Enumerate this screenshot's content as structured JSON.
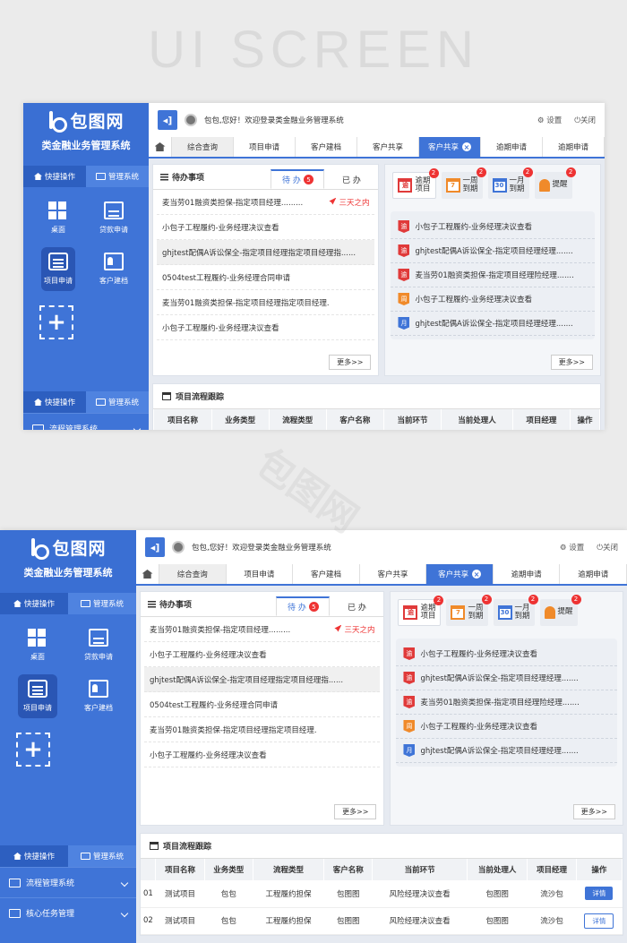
{
  "hero_title": "UI SCREEN",
  "brand": {
    "logo": "包图网",
    "system": "类金融业务管理系统"
  },
  "sidebar": {
    "tab_quick": "快捷操作",
    "tab_manage": "管理系统",
    "grid": [
      {
        "label": "桌面",
        "icon": "desktop-icon"
      },
      {
        "label": "贷款申请",
        "icon": "loan-icon"
      },
      {
        "label": "项目申请",
        "icon": "project-icon",
        "selected": true
      },
      {
        "label": "客户建档",
        "icon": "customer-icon"
      }
    ],
    "add_label": "+",
    "menu": [
      {
        "label": "流程管理系统"
      },
      {
        "label": "核心任务管理"
      }
    ]
  },
  "topbar": {
    "back": "◂]",
    "welcome": "包包,您好！欢迎登录类金融业务管理系统",
    "settings": "设置",
    "logout": "关闭"
  },
  "navtabs": [
    "综合查询",
    "项目申请",
    "客户建档",
    "客户共享",
    "客户共享",
    "逾期申请",
    "逾期申请"
  ],
  "todo": {
    "title": "待办事项",
    "tab_todo": "待 办",
    "tab_todo_count": "5",
    "tab_done": "已 办",
    "urgent": "三天之内",
    "items": [
      "麦当劳01融资类担保-指定项目经理.........",
      "小包子工程履约-业务经理决议查看",
      "ghjtest配偶A诉讼保全-指定项目经理指定项目经理指......",
      "0504test工程履约-业务经理合同申请",
      "麦当劳01融资类担保-指定项目经理指定项目经理.",
      "小包子工程履约-业务经理决议查看"
    ],
    "more": "更多>>"
  },
  "alerts": {
    "cats": [
      {
        "l1": "逾期",
        "l2": "项目",
        "cal": "逾",
        "color": "#e03a3a",
        "badge": "2"
      },
      {
        "l1": "一周",
        "l2": "到期",
        "cal": "7",
        "color": "#f08a2a",
        "badge": "2"
      },
      {
        "l1": "一月",
        "l2": "到期",
        "cal": "30",
        "color": "#3f74d7",
        "badge": "2"
      },
      {
        "l1": "提醒",
        "l2": "",
        "cal": "",
        "color": "#f08a2a",
        "badge": "2"
      }
    ],
    "items": [
      {
        "tag": "逾",
        "color": "#e03a3a",
        "text": "小包子工程履约-业务经理决议查看"
      },
      {
        "tag": "逾",
        "color": "#e03a3a",
        "text": "ghjtest配偶A诉讼保全-指定项目经理经理......."
      },
      {
        "tag": "逾",
        "color": "#e03a3a",
        "text": "麦当劳01融资类担保-指定项目经理险经理......."
      },
      {
        "tag": "周",
        "color": "#f08a2a",
        "text": "小包子工程履约-业务经理决议查看"
      },
      {
        "tag": "月",
        "color": "#3f74d7",
        "text": "ghjtest配偶A诉讼保全-指定项目经理经理......."
      }
    ],
    "more": "更多>>"
  },
  "flow": {
    "title": "项目流程跟踪",
    "headers": [
      "",
      "项目名称",
      "业务类型",
      "流程类型",
      "客户名称",
      "当前环节",
      "当前处理人",
      "项目经理",
      "操作"
    ],
    "rows": [
      [
        "01",
        "测试项目",
        "包包",
        "工程履约担保",
        "包图图",
        "风险经理决议查看",
        "包图图",
        "流沙包",
        "详情"
      ],
      [
        "02",
        "测试项目",
        "包包",
        "工程履约担保",
        "包图图",
        "风险经理决议查看",
        "包图图",
        "流沙包",
        "详情"
      ]
    ]
  },
  "watermark": "包图网"
}
